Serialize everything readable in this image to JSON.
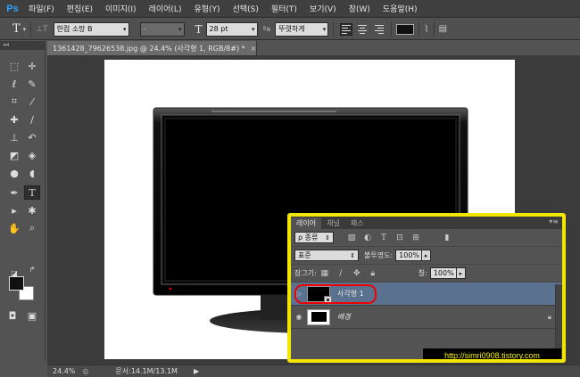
{
  "app": {
    "logo": "Ps"
  },
  "menu": [
    {
      "label": "파일(F)"
    },
    {
      "label": "편집(E)"
    },
    {
      "label": "이미지(I)"
    },
    {
      "label": "레이어(L)"
    },
    {
      "label": "유형(Y)"
    },
    {
      "label": "선택(S)"
    },
    {
      "label": "필터(T)"
    },
    {
      "label": "보기(V)"
    },
    {
      "label": "창(W)"
    },
    {
      "label": "도움말(H)"
    }
  ],
  "options": {
    "tool_glyph": "T",
    "orient_glyph": "⊥T",
    "font_family": "한컴 소망 B",
    "font_style": "-",
    "size_glyph": "T",
    "font_size": "28 pt",
    "aa_label": "ªa",
    "antialias": "뚜렷하게",
    "text_color": "#111111"
  },
  "document": {
    "tab_title": "1361428_79626538.jpg @ 24.4% (사각형 1, RGB/8#) *",
    "close": "×"
  },
  "status": {
    "zoom": "24.4%",
    "doc_size": "문서:14.1M/13.1M",
    "arrow": "▶"
  },
  "layers_panel": {
    "tabs": [
      {
        "label": "레이어"
      },
      {
        "label": "채널"
      },
      {
        "label": "패스"
      }
    ],
    "menu": "▾≡",
    "filter_kind": "ρ 종류",
    "blend_mode": "표준",
    "opacity_label": "불투명도:",
    "opacity_value": "100%",
    "lock_label": "잠그기:",
    "fill_label": "칠:",
    "fill_value": "100%",
    "layers": [
      {
        "name": "사각형 1",
        "selected": true
      },
      {
        "name": "배경",
        "selected": false
      }
    ],
    "watermark": "http://simri0908.tistory.com"
  }
}
